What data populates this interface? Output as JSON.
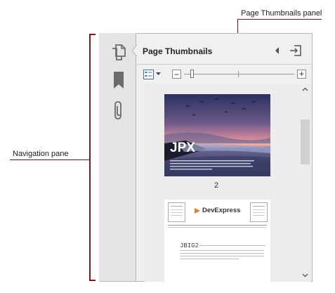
{
  "annotations": {
    "thumbnails_panel": "Page Thumbnails panel",
    "navigation_pane": "Navigation pane"
  },
  "panel": {
    "title": "Page Thumbnails"
  },
  "nav_icons": [
    "page-thumbnails-icon",
    "bookmark-icon",
    "attachment-icon"
  ],
  "zoom": {
    "minus": "−",
    "plus": "+",
    "level": 0.07
  },
  "thumbnails": [
    {
      "title": "JPX",
      "page_label": "2"
    },
    {
      "logo": "DevExpress",
      "heading": "JBIG2"
    }
  ],
  "colors": {
    "annotation_line": "#8b1018",
    "nav_background": "#e4e4e4",
    "panel_background": "#f0f0f0",
    "icon_gray": "#6b6b6b"
  }
}
